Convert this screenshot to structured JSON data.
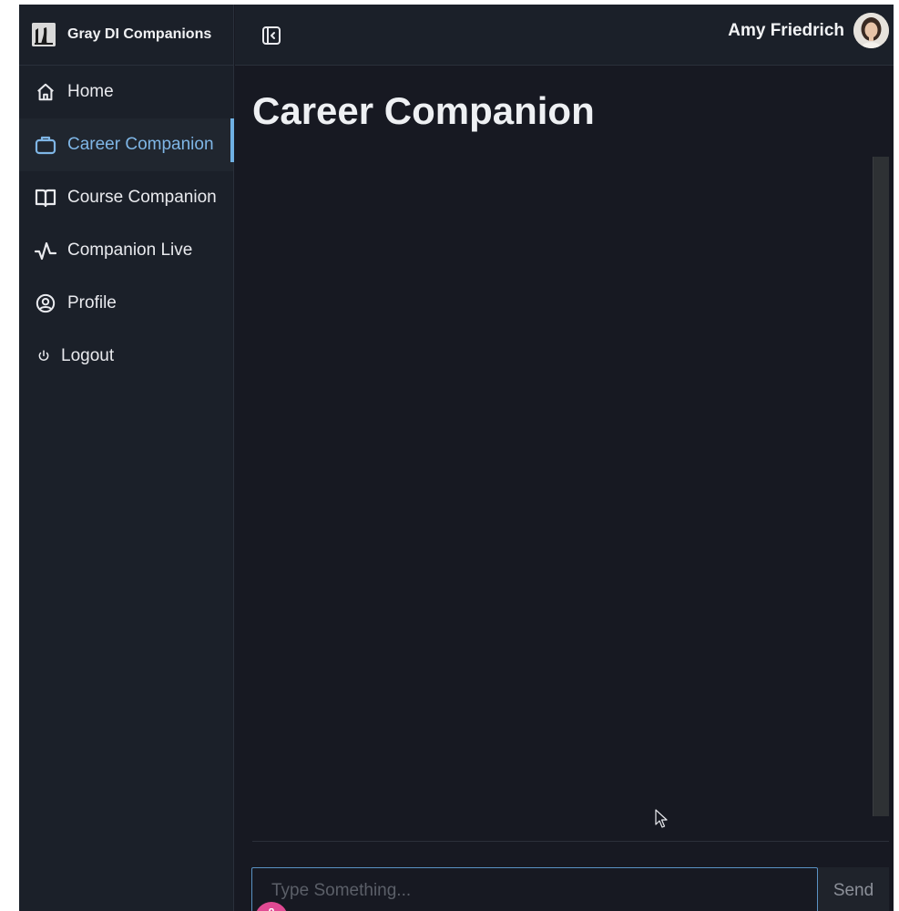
{
  "brand": {
    "name": "Gray DI Companions",
    "logo_icon": "brand-logo-icon"
  },
  "sidebar": {
    "items": [
      {
        "label": "Home",
        "icon": "home-icon",
        "active": false
      },
      {
        "label": "Career Companion",
        "icon": "briefcase-icon",
        "active": true
      },
      {
        "label": "Course Companion",
        "icon": "book-icon",
        "active": false
      },
      {
        "label": "Companion Live",
        "icon": "waveform-icon",
        "active": false
      },
      {
        "label": "Profile",
        "icon": "user-circle-icon",
        "active": false
      },
      {
        "label": "Logout",
        "icon": "power-icon",
        "active": false
      }
    ]
  },
  "header": {
    "collapse_icon": "sidebar-collapse-icon",
    "user_name": "Amy Friedrich"
  },
  "main": {
    "title": "Career Companion",
    "input_placeholder": "Type Something...",
    "send_label": "Send",
    "mic_icon": "microphone-icon"
  },
  "colors": {
    "background": "#171922",
    "sidebar": "#1b2029",
    "accent": "#7fb6e6",
    "mic": "#e04a93"
  }
}
